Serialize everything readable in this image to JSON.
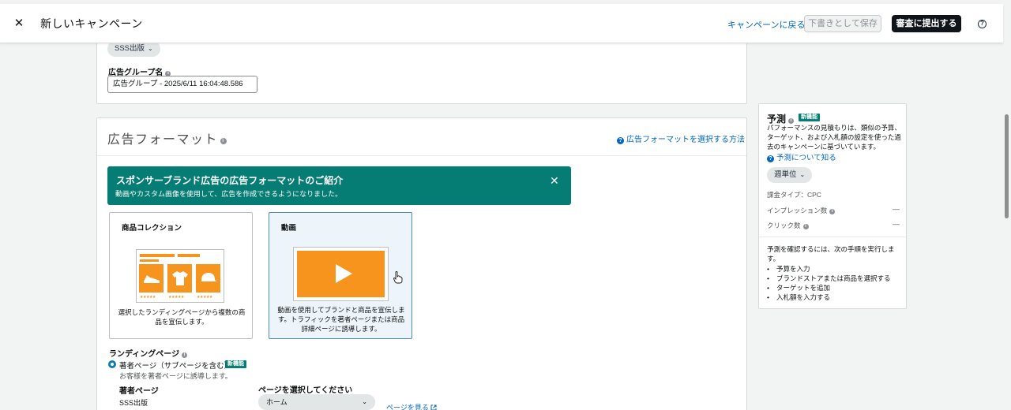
{
  "header": {
    "title": "新しいキャンペーン",
    "back_label": "キャンペーンに戻る",
    "draft_label": "下書きとして保存",
    "submit_label": "審査に提出する",
    "help_glyph": "?"
  },
  "ad_group": {
    "brand_pill": "SSS出版",
    "name_label": "広告グループ名",
    "name_value": "広告グループ - 2025/6/11 16:04:48.586"
  },
  "ad_format": {
    "title": "広告フォーマット",
    "howto_link": "広告フォーマットを選択する方法",
    "banner": {
      "title": "スポンサーブランド広告の広告フォーマットのご紹介",
      "subtitle": "動画やカスタム画像を使用して、広告を作成できるようになりました。"
    },
    "formats": [
      {
        "title": "商品コレクション",
        "description": "選択したランディングページから複数の商品を宣伝します。",
        "selected": false
      },
      {
        "title": "動画",
        "description": "動画を使用してブランドと商品を宣伝します。トラフィックを著者ページまたは商品詳細ページに誘導します。",
        "selected": true
      }
    ],
    "landing_page": {
      "label": "ランディングページ",
      "option_label": "著者ページ（サブページを含む）",
      "new_badge": "新機能",
      "option_desc": "お客様を著者ページに誘導します。",
      "author_label": "著者ページ",
      "author_value": "SSS出版",
      "select_label": "ページを選択してください",
      "select_value": "ホーム",
      "view_page_link": "ページを見る"
    }
  },
  "forecast": {
    "title": "予測",
    "new_badge": "新機能",
    "description": "パフォーマンスの見積もりは、類似の予算、ターゲット、および入札額の設定を使った過去のキャンペーンに基づいています。",
    "learn_link": "予測について知る",
    "period": "週単位",
    "billing_type": "課金タイプ：CPC",
    "impressions_label": "インプレッション数",
    "impressions_value": "—",
    "clicks_label": "クリック数",
    "clicks_value": "—",
    "steps_intro": "予測を確認するには、次の手順を実行します。",
    "steps": [
      "予算を入力",
      "ブランドストアまたは商品を選択する",
      "ターゲットを追加",
      "入札額を入力する"
    ]
  },
  "colors": {
    "banner": "#067d74",
    "submit_button": "#0f141a",
    "link": "#0066c0",
    "illustration": "#f7941d"
  },
  "icons": [
    "close-icon",
    "help-icon",
    "chevron-down-icon",
    "info-icon",
    "question-icon",
    "external-link-icon",
    "play-icon",
    "pointer-hand-icon"
  ]
}
